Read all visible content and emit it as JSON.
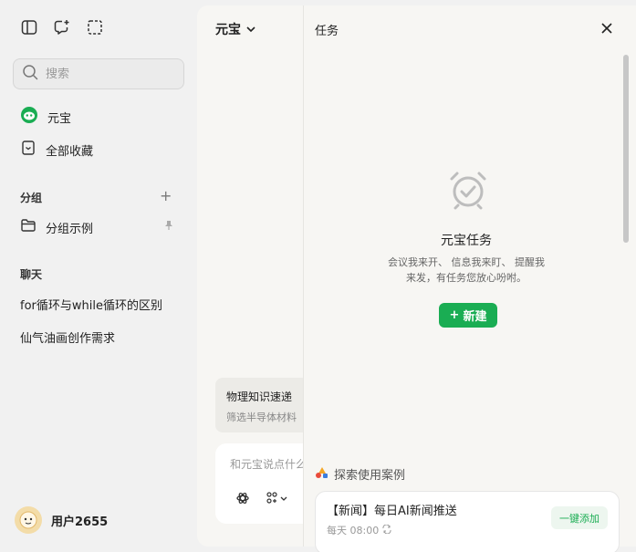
{
  "sidebar": {
    "search_placeholder": "搜索",
    "nav": [
      {
        "label": "元宝",
        "icon": "yuanbao-logo-icon"
      },
      {
        "label": "全部收藏",
        "icon": "bookmark-icon"
      }
    ],
    "groups_label": "分组",
    "group_items": [
      {
        "label": "分组示例"
      }
    ],
    "chats_label": "聊天",
    "chats": [
      {
        "label": "for循环与while循环的区别"
      },
      {
        "label": "仙气油画创作需求"
      }
    ],
    "user_name": "用户2655"
  },
  "main": {
    "model_name": "元宝",
    "suggestion_title": "物理知识速递",
    "suggestion_sub": "筛选半导体材料",
    "input_placeholder": "和元宝说点什么"
  },
  "panel": {
    "title": "任务",
    "empty_title": "元宝任务",
    "empty_desc": "会议我来开、 信息我来盯、 提醒我来发，有任务您放心吩咐。",
    "new_label": "新建",
    "explore_label": "探索使用案例",
    "case": {
      "title": "【新闻】每日AI新闻推送",
      "schedule": "每天 08:00",
      "add_label": "一键添加"
    }
  },
  "colors": {
    "accent": "#1aad53",
    "background": "#f1f1f1",
    "panel": "#f7f6f3"
  }
}
